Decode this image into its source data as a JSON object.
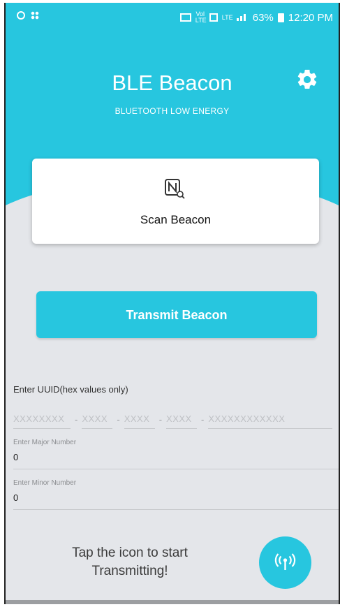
{
  "status_bar": {
    "right_text": "63%",
    "time": "12:20 PM",
    "small_labels": [
      "Vol LTE",
      "LTE"
    ]
  },
  "header": {
    "title": "BLE Beacon",
    "subtitle": "BLUETOOTH LOW ENERGY",
    "settings_icon": "gear-icon"
  },
  "scan_card": {
    "icon": "nfc-search-icon",
    "label": "Scan Beacon"
  },
  "transmit_button": {
    "label": "Transmit Beacon"
  },
  "uuid": {
    "label": "Enter UUID(hex values only)",
    "placeholders": [
      "XXXXXXXX",
      "XXXX",
      "XXXX",
      "XXXX",
      "XXXXXXXXXXXX"
    ],
    "separator": "-"
  },
  "major": {
    "label": "Enter Major Number",
    "value": "0"
  },
  "minor": {
    "label": "Enter Minor Number",
    "value": "0"
  },
  "footer": {
    "hint_line1": "Tap the icon to start",
    "hint_line2": "Transmitting!",
    "fab_icon": "broadcast-icon"
  },
  "colors": {
    "accent": "#27c6df",
    "background": "#e4e6ea"
  }
}
